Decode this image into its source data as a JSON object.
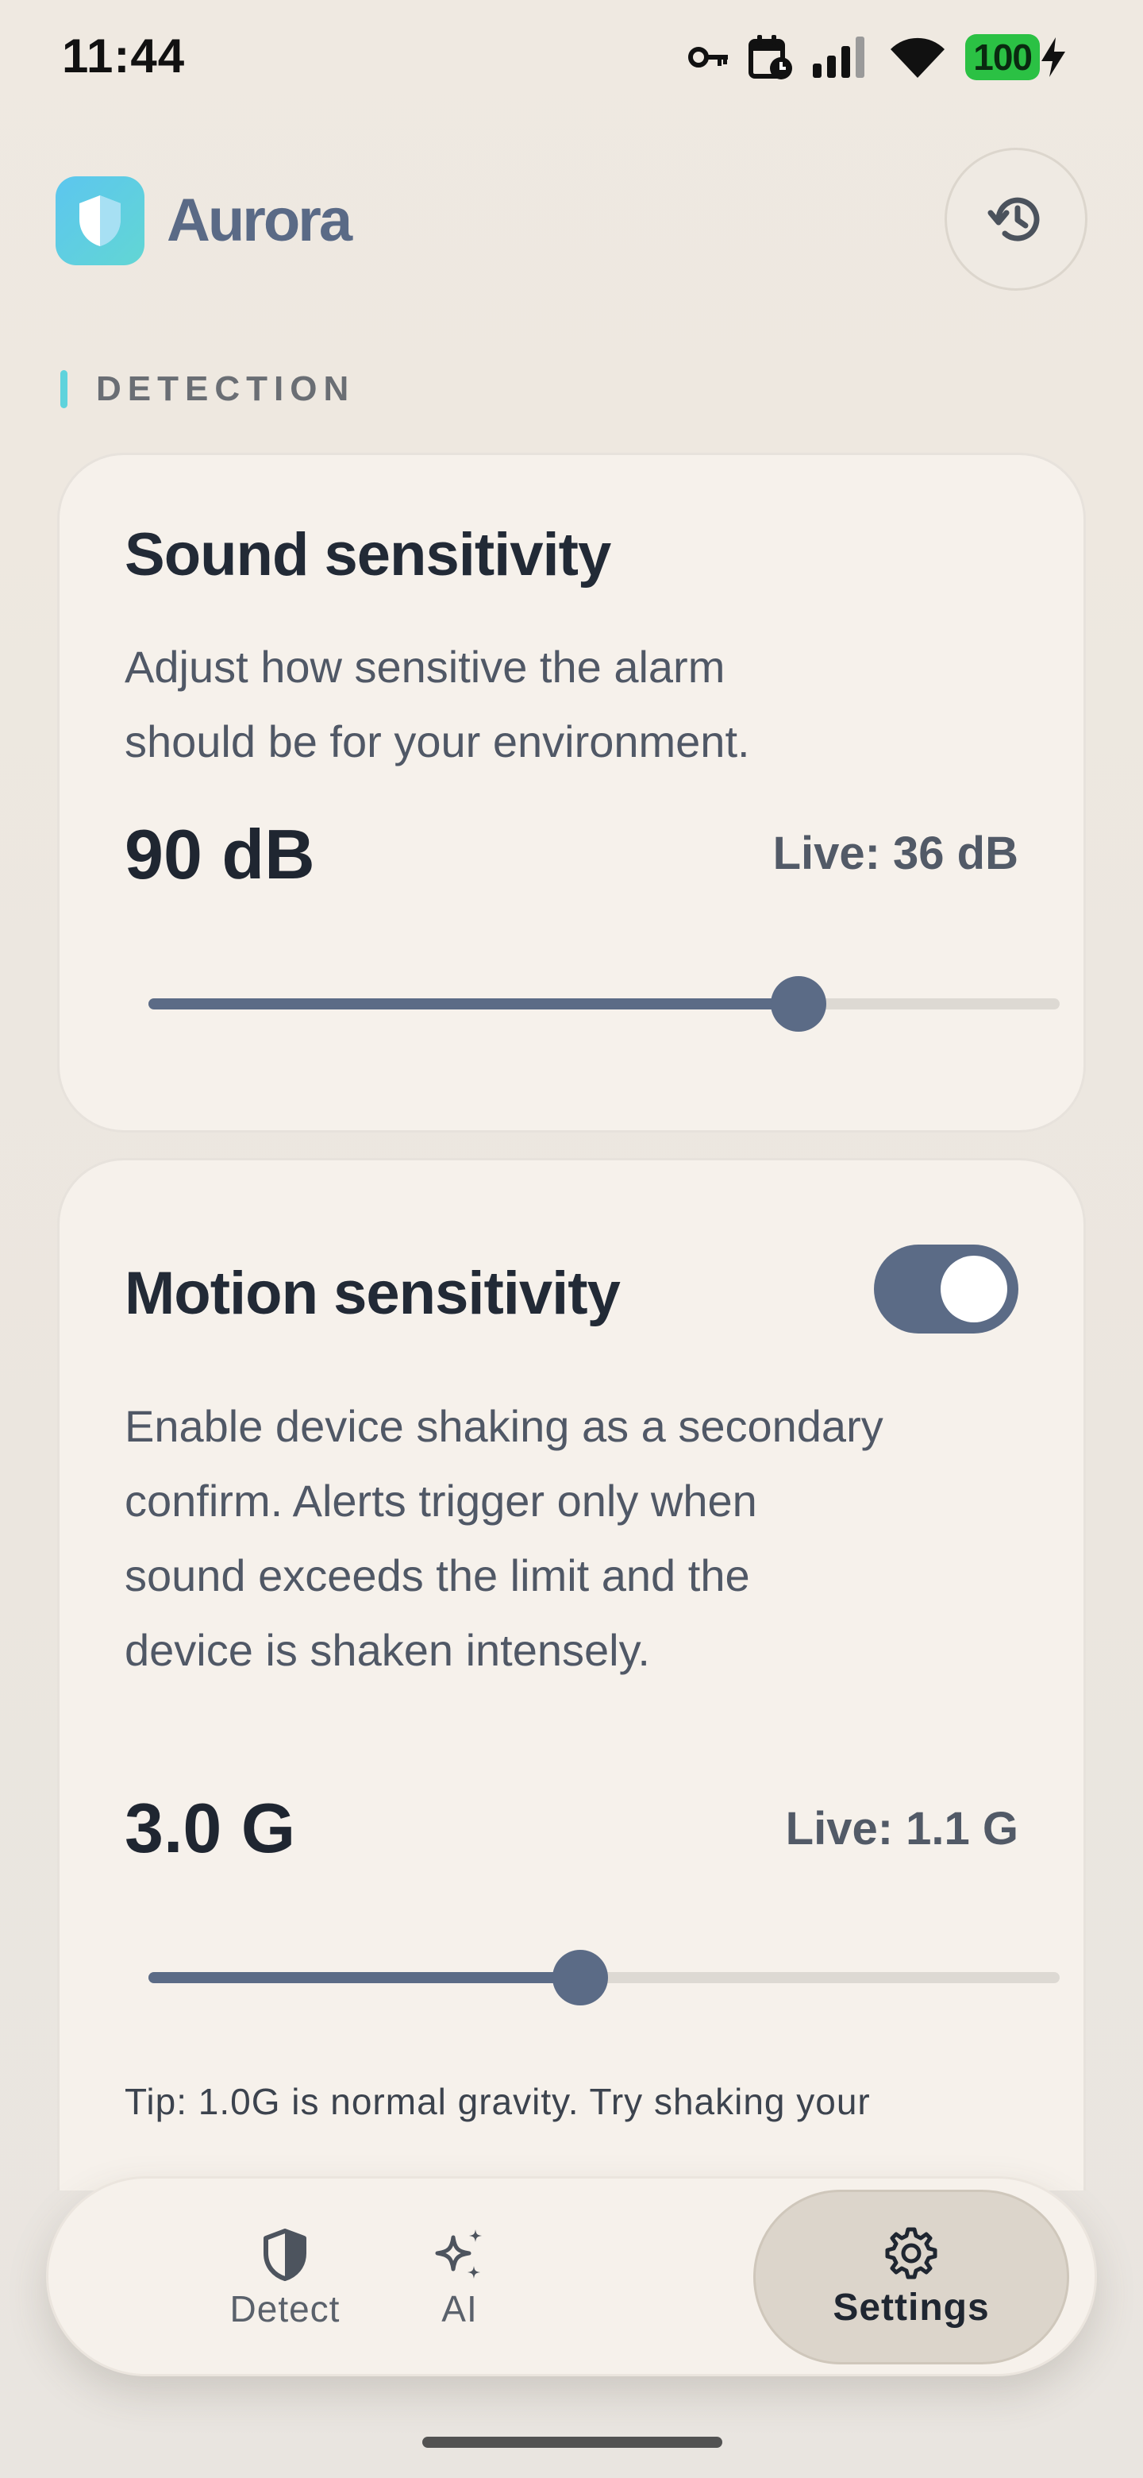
{
  "status_bar": {
    "time": "11:44",
    "battery": "100",
    "icons": [
      "key-icon",
      "calendar-clock-icon",
      "cellular-signal-icon",
      "wifi-icon",
      "battery-charging-icon"
    ]
  },
  "header": {
    "app_name": "Aurora",
    "logo_icon": "shield-icon",
    "history_icon": "history-icon"
  },
  "section": {
    "label": "DETECTION"
  },
  "sound_card": {
    "title": "Sound sensitivity",
    "description_line1": "Adjust how sensitive the alarm",
    "description_line2": "should be for your environment.",
    "value": "90 dB",
    "live": "Live: 36 dB",
    "slider_fraction": 0.713
  },
  "motion_card": {
    "title": "Motion sensitivity",
    "toggle_on": true,
    "description_line1": "Enable device shaking as a secondary",
    "description_line2": "confirm. Alerts trigger only when",
    "description_line3": "sound exceeds the limit and the",
    "description_line4": "device is shaken intensely.",
    "value": "3.0 G",
    "live": "Live: 1.1 G",
    "slider_fraction": 0.474,
    "tip": "Tip: 1.0G is normal gravity. Try shaking your"
  },
  "bottom_nav": {
    "items": [
      {
        "label": "Detect",
        "icon": "shield-icon",
        "active": false
      },
      {
        "label": "AI",
        "icon": "sparkles-icon",
        "active": false
      },
      {
        "label": "Settings",
        "icon": "gear-icon",
        "active": true
      }
    ]
  },
  "colors": {
    "accent": "#5b6b86",
    "teal": "#5fd3dc",
    "battery": "#2bc144"
  }
}
